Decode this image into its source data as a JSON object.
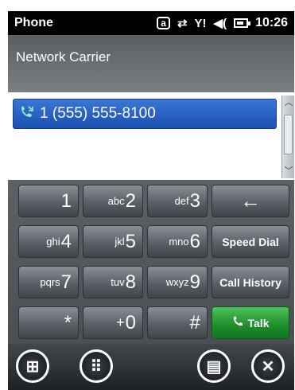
{
  "status_bar": {
    "title": "Phone",
    "a_icon": "a",
    "sync_icon": "⇄",
    "signal_icon": "Y!",
    "volume_icon": "◀(",
    "time": "10:26"
  },
  "carrier": {
    "name": "Network Carrier"
  },
  "call_log": {
    "entries": [
      {
        "number": "1 (555) 555-8100",
        "icon": "phone-incoming-icon"
      }
    ]
  },
  "keypad": {
    "keys": [
      {
        "main": "1",
        "sub": ""
      },
      {
        "main": "2",
        "sub": "abc"
      },
      {
        "main": "3",
        "sub": "def"
      },
      {
        "main": "←",
        "sub": ""
      },
      {
        "main": "4",
        "sub": "ghi"
      },
      {
        "main": "5",
        "sub": "jkl"
      },
      {
        "main": "6",
        "sub": "mno"
      },
      {
        "main": "Speed Dial",
        "sub": ""
      },
      {
        "main": "7",
        "sub": "pqrs"
      },
      {
        "main": "8",
        "sub": "tuv"
      },
      {
        "main": "9",
        "sub": "wxyz"
      },
      {
        "main": "Call History",
        "sub": ""
      },
      {
        "main": "*",
        "sub": ""
      },
      {
        "main": "0",
        "sub": "+"
      },
      {
        "main": "#",
        "sub": ""
      },
      {
        "main": "Talk",
        "sub": ""
      }
    ]
  },
  "bottom_bar": {
    "start_glyph": "⊞",
    "keypad_glyph": "⠿",
    "menu_glyph": "▤",
    "close_glyph": "✕"
  },
  "colors": {
    "talk_green": "#1c8d2a",
    "selection_blue": "#2a62c8"
  }
}
